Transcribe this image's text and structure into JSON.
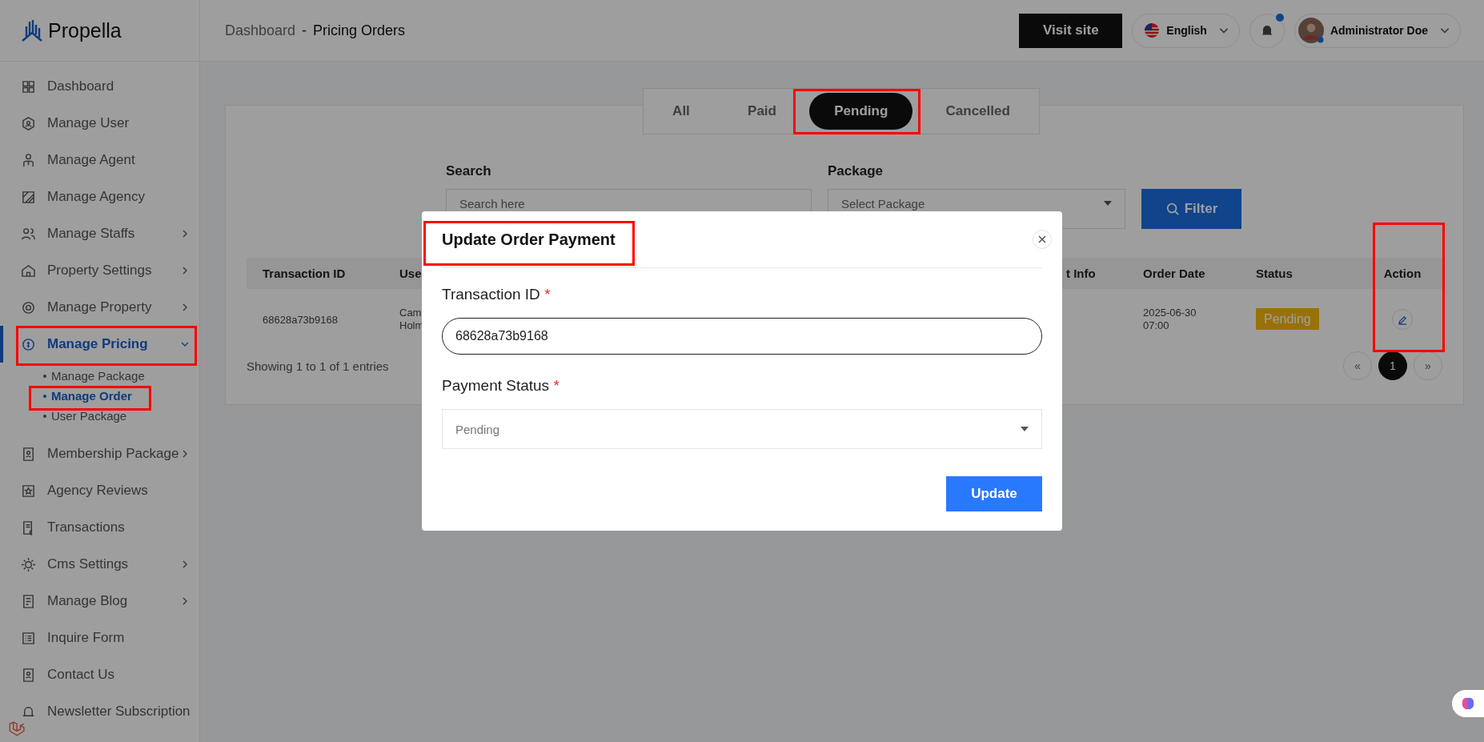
{
  "sidebar": {
    "logo": "Propella",
    "items": [
      {
        "label": "Dashboard",
        "selected": false,
        "expandable": false
      },
      {
        "label": "Manage User",
        "selected": false,
        "expandable": false
      },
      {
        "label": "Manage Agent",
        "selected": false,
        "expandable": false
      },
      {
        "label": "Manage Agency",
        "selected": false,
        "expandable": false
      },
      {
        "label": "Manage Staffs",
        "selected": false,
        "expandable": true
      },
      {
        "label": "Property Settings",
        "selected": false,
        "expandable": true
      },
      {
        "label": "Manage Property",
        "selected": false,
        "expandable": true
      },
      {
        "label": "Manage Pricing",
        "selected": true,
        "expandable": true,
        "expanded": true,
        "highlighted": true,
        "children": [
          {
            "label": "Manage Package",
            "selected": false,
            "highlighted": false
          },
          {
            "label": "Manage Order",
            "selected": true,
            "highlighted": true
          },
          {
            "label": "User Package",
            "selected": false,
            "highlighted": false
          }
        ]
      },
      {
        "label": "Membership Package",
        "selected": false,
        "expandable": true
      },
      {
        "label": "Agency Reviews",
        "selected": false,
        "expandable": false
      },
      {
        "label": "Transactions",
        "selected": false,
        "expandable": false
      },
      {
        "label": "Cms Settings",
        "selected": false,
        "expandable": true
      },
      {
        "label": "Manage Blog",
        "selected": false,
        "expandable": true
      },
      {
        "label": "Inquire Form",
        "selected": false,
        "expandable": false
      },
      {
        "label": "Contact Us",
        "selected": false,
        "expandable": false
      },
      {
        "label": "Newsletter Subscription",
        "selected": false,
        "expandable": false
      }
    ]
  },
  "header": {
    "breadcrumb": [
      "Dashboard",
      "-",
      "Pricing Orders"
    ],
    "visit_button": "Visit site",
    "language": "English",
    "notification_dot": true,
    "user": "Administrator Doe"
  },
  "tabs": [
    {
      "label": "All",
      "selected": false,
      "highlighted": false
    },
    {
      "label": "Paid",
      "selected": false,
      "highlighted": false
    },
    {
      "label": "Pending",
      "selected": true,
      "highlighted": true
    },
    {
      "label": "Cancelled",
      "selected": false,
      "highlighted": false
    }
  ],
  "filters": {
    "search_label": "Search",
    "search_placeholder": "Search here",
    "package_label": "Package",
    "package_placeholder": "Select Package",
    "filter_button": "Filter"
  },
  "table": {
    "columns": [
      {
        "label": "Transaction ID",
        "highlighted": false
      },
      {
        "label": "Use",
        "highlighted": false
      },
      {
        "label": "t Info",
        "highlighted": false
      },
      {
        "label": "Order Date",
        "highlighted": false
      },
      {
        "label": "Status",
        "highlighted": false
      },
      {
        "label": "Action",
        "highlighted": true
      }
    ],
    "rows": [
      {
        "transaction_id": "68628a73b9168",
        "user": "Cam Holm",
        "order_date": "2025-06-30 07:00",
        "status": "Pending"
      }
    ],
    "footer": "Showing 1 to 1 of 1 entries",
    "pages": [
      {
        "label": "«",
        "selected": false
      },
      {
        "label": "1",
        "selected": true
      },
      {
        "label": "»",
        "selected": false
      }
    ]
  },
  "modal": {
    "title": "Update Order Payment",
    "title_highlighted": true,
    "fields": [
      {
        "label": "Transaction ID",
        "required": "*",
        "kind": "input",
        "value": "68628a73b9168"
      },
      {
        "label": "Payment Status",
        "required": "*",
        "kind": "select",
        "value": "Pending"
      }
    ],
    "button": "Update"
  }
}
